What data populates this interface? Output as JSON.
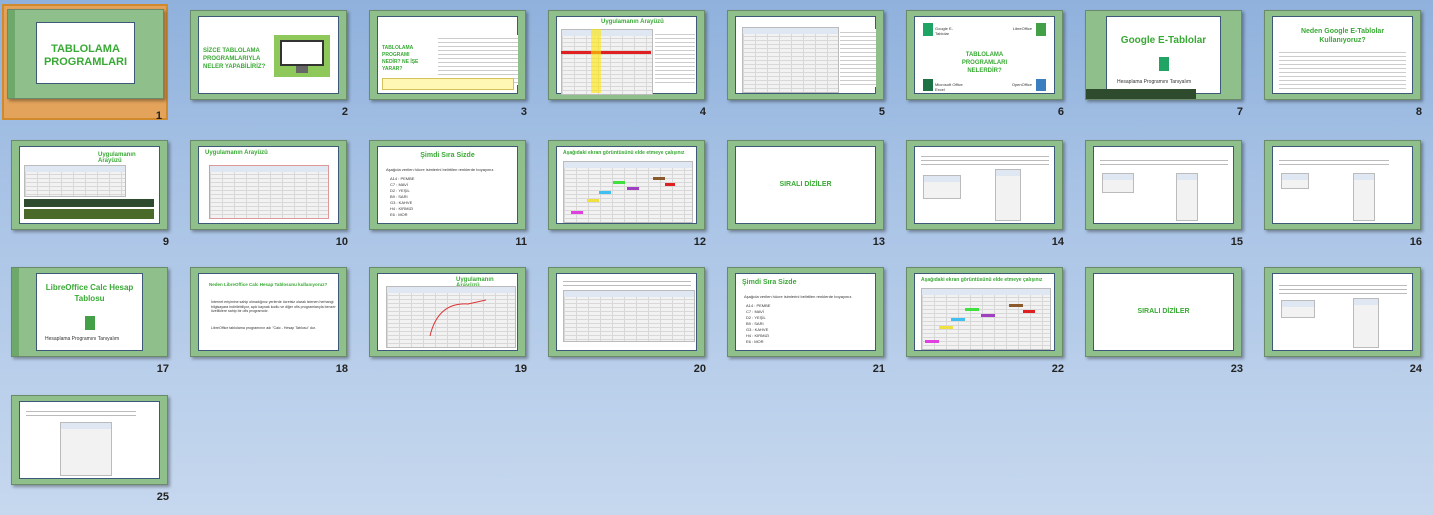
{
  "slides": [
    {
      "num": "1",
      "title": "TABLOLAMA PROGRAMLARI"
    },
    {
      "num": "2",
      "title": "SİZCE TABLOLAMA PROGRAMLARIYLA NELER YAPABİLİRİZ?"
    },
    {
      "num": "3",
      "title": "TABLOLAMA PROGRAMI NEDİR? NE İŞE YARAR?"
    },
    {
      "num": "4",
      "title": "Uygulamanın Arayüzü"
    },
    {
      "num": "5",
      "title": ""
    },
    {
      "num": "6",
      "title": "TABLOLAMA PROGRAMLARI NELERDİR?",
      "labels": [
        "Google E-Tablolar",
        "LibreOffice",
        "Microsoft Office Excel",
        "OpenOffice"
      ]
    },
    {
      "num": "7",
      "title": "Google E-Tablolar",
      "subtitle": "Hesaplama Programını Tanıyalım"
    },
    {
      "num": "8",
      "title": "Neden Google E-Tablolar Kullanıyoruz?"
    },
    {
      "num": "9",
      "title": "Uygulamanın Arayüzü"
    },
    {
      "num": "10",
      "title": "Uygulamanın Arayüzü"
    },
    {
      "num": "11",
      "title": "Şimdi Sıra Sizde",
      "intro": "Aşağıda verilen hücre isimlerini belirtilen renklerde boyayınız.",
      "items": [
        "A14 : PEMBE",
        "C7 : MAVİ",
        "D2 : YEŞİL",
        "B9 : SARI",
        "G3 : KAHVE",
        "H4 : KIRMIZI",
        "E6 : MOR"
      ]
    },
    {
      "num": "12",
      "title": "Aşağıdaki ekran görüntüsünü elde etmeye çalışınız"
    },
    {
      "num": "13",
      "title": "SIRALI DİZİLER"
    },
    {
      "num": "14",
      "title": ""
    },
    {
      "num": "15",
      "title": ""
    },
    {
      "num": "16",
      "title": ""
    },
    {
      "num": "17",
      "title": "LibreOffice Calc Hesap Tablosu",
      "subtitle": "Hesaplama Programını Tanıyalım"
    },
    {
      "num": "18",
      "title": "Neden LibreOffice Calc Hesap Tablosunu kullanıyoruz?",
      "bullets": [
        "İnternet erişimine sahip olmadığınız yerlerde ücretsiz olarak istenen herhangi bilgisayara indirilebiliyor, açık kaynak kodlu ve diğer ofis programlarıyla benzer özelliklere sahip bir ofis programıdır.",
        "LibreOffice tablolama programının adı \"Calc - Hesap Tablosu\" dur."
      ]
    },
    {
      "num": "19",
      "title": "Uygulamanın Arayüzü"
    },
    {
      "num": "20",
      "title": ""
    },
    {
      "num": "21",
      "title": "Şimdi Sıra Sizde",
      "intro": "Aşağıda verilen hücre isimlerini belirtilen renklerde boyayınız.",
      "items": [
        "A14 : PEMBE",
        "C7 : MAVİ",
        "D2 : YEŞİL",
        "B9 : SARI",
        "G3 : KAHVE",
        "H4 : KIRMIZI",
        "E6 : MOR"
      ]
    },
    {
      "num": "22",
      "title": "Aşağıdaki ekran görüntüsünü elde etmeye çalışınız"
    },
    {
      "num": "23",
      "title": "SIRALI DİZİLER"
    },
    {
      "num": "24",
      "title": ""
    },
    {
      "num": "25",
      "title": ""
    }
  ],
  "colors": {
    "green": "#39a935",
    "selected": "#e3a35a",
    "background": "#9fbde3"
  }
}
